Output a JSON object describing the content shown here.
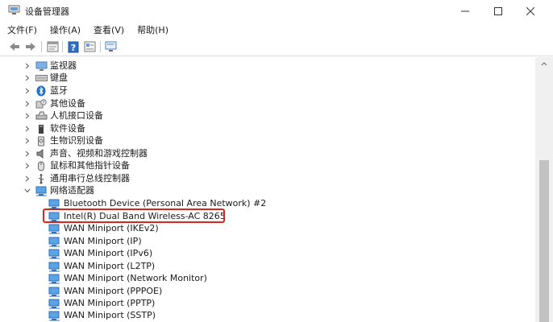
{
  "window": {
    "title": "设备管理器"
  },
  "menu": [
    "文件(F)",
    "操作(A)",
    "查看(V)",
    "帮助(H)"
  ],
  "toolbar": {
    "icons": [
      "back-arrow-icon",
      "forward-arrow-icon",
      "properties-icon",
      "help-icon",
      "update-driver-icon",
      "scan-hardware-icon"
    ]
  },
  "tree": {
    "categories": [
      {
        "label": "监视器",
        "icon": "monitor-icon"
      },
      {
        "label": "键盘",
        "icon": "keyboard-icon"
      },
      {
        "label": "蓝牙",
        "icon": "bluetooth-icon"
      },
      {
        "label": "其他设备",
        "icon": "other-device-icon"
      },
      {
        "label": "人机接口设备",
        "icon": "hid-icon"
      },
      {
        "label": "软件设备",
        "icon": "software-device-icon"
      },
      {
        "label": "生物识别设备",
        "icon": "biometric-icon"
      },
      {
        "label": "声音、视频和游戏控制器",
        "icon": "speaker-icon"
      },
      {
        "label": "鼠标和其他指针设备",
        "icon": "mouse-icon"
      },
      {
        "label": "通用串行总线控制器",
        "icon": "usb-icon"
      }
    ],
    "network_adapters": {
      "label": "网络适配器",
      "icon": "network-adapter-icon",
      "children": [
        "Bluetooth Device (Personal Area Network) #2",
        "Intel(R) Dual Band Wireless-AC 8265",
        "WAN Miniport (IKEv2)",
        "WAN Miniport (IP)",
        "WAN Miniport (IPv6)",
        "WAN Miniport (L2TP)",
        "WAN Miniport (Network Monitor)",
        "WAN Miniport (PPPOE)",
        "WAN Miniport (PPTP)",
        "WAN Miniport (SSTP)"
      ]
    }
  },
  "colors": {
    "highlight_border": "#d9261c",
    "network_icon": "#3a8fd6"
  }
}
